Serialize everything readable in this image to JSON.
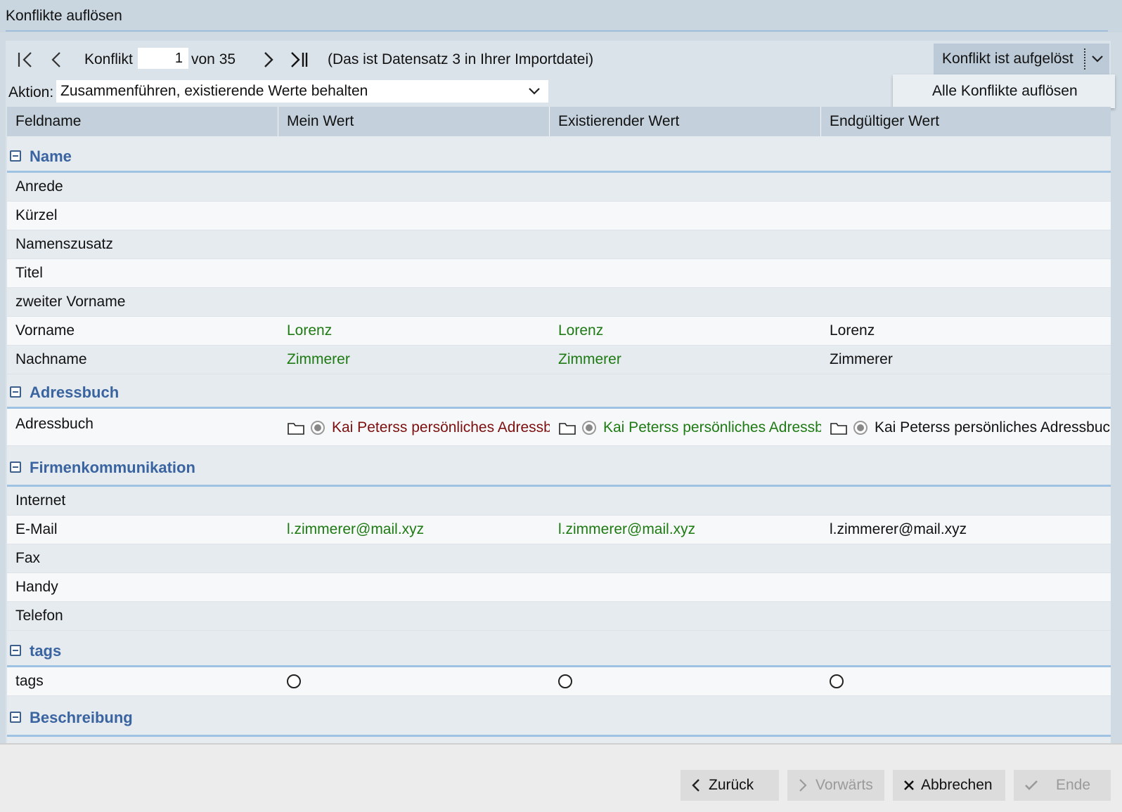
{
  "window": {
    "title": "Konflikte auflösen"
  },
  "nav": {
    "conflict_label": "Konflikt",
    "current": "1",
    "of_label": "von 35",
    "record_info": "(Das ist Datensatz 3 in Ihrer Importdatei)"
  },
  "resolve_button": {
    "label": "Konflikt ist aufgelöst"
  },
  "resolve_menu": {
    "items": [
      "Alle Konflikte auflösen"
    ]
  },
  "action": {
    "label": "Aktion:",
    "value": "Zusammenführen, existierende Werte behalten"
  },
  "columns": [
    "Feldname",
    "Mein Wert",
    "Existierender Wert",
    "Endgültiger Wert"
  ],
  "groups": {
    "name": {
      "title": "Name",
      "rows": [
        {
          "field": "Anrede",
          "mine": "",
          "existing": "",
          "final": ""
        },
        {
          "field": "Kürzel",
          "mine": "",
          "existing": "",
          "final": ""
        },
        {
          "field": "Namenszusatz",
          "mine": "",
          "existing": "",
          "final": ""
        },
        {
          "field": "Titel",
          "mine": "",
          "existing": "",
          "final": ""
        },
        {
          "field": "zweiter Vorname",
          "mine": "",
          "existing": "",
          "final": ""
        },
        {
          "field": "Vorname",
          "mine": "Lorenz",
          "existing": "Lorenz",
          "final": "Lorenz"
        },
        {
          "field": "Nachname",
          "mine": "Zimmerer",
          "existing": "Zimmerer",
          "final": "Zimmerer"
        }
      ]
    },
    "addressbook": {
      "title": "Adressbuch",
      "rows": [
        {
          "field": "Adressbuch",
          "mine": "Kai Peterss persönliches Adressbuch",
          "existing": "Kai Peterss persönliches Adressbuch",
          "final": "Kai Peterss persönliches Adressbuch"
        }
      ]
    },
    "company": {
      "title": "Firmenkommunikation",
      "rows": [
        {
          "field": "Internet",
          "mine": "",
          "existing": "",
          "final": ""
        },
        {
          "field": "E-Mail",
          "mine": "l.zimmerer@mail.xyz",
          "existing": "l.zimmerer@mail.xyz",
          "final": "l.zimmerer@mail.xyz"
        },
        {
          "field": "Fax",
          "mine": "",
          "existing": "",
          "final": ""
        },
        {
          "field": "Handy",
          "mine": "",
          "existing": "",
          "final": ""
        },
        {
          "field": "Telefon",
          "mine": "",
          "existing": "",
          "final": ""
        }
      ]
    },
    "tags": {
      "title": "tags",
      "rows": [
        {
          "field": "tags"
        }
      ]
    },
    "description": {
      "title": "Beschreibung"
    }
  },
  "footer": {
    "back": "Zurück",
    "forward": "Vorwärts",
    "cancel": "Abbrechen",
    "finish": "Ende"
  },
  "colors": {
    "group_title": "#3a64a0",
    "mine_value": "#1e7a12",
    "conflict_value": "#7d0f0f"
  }
}
